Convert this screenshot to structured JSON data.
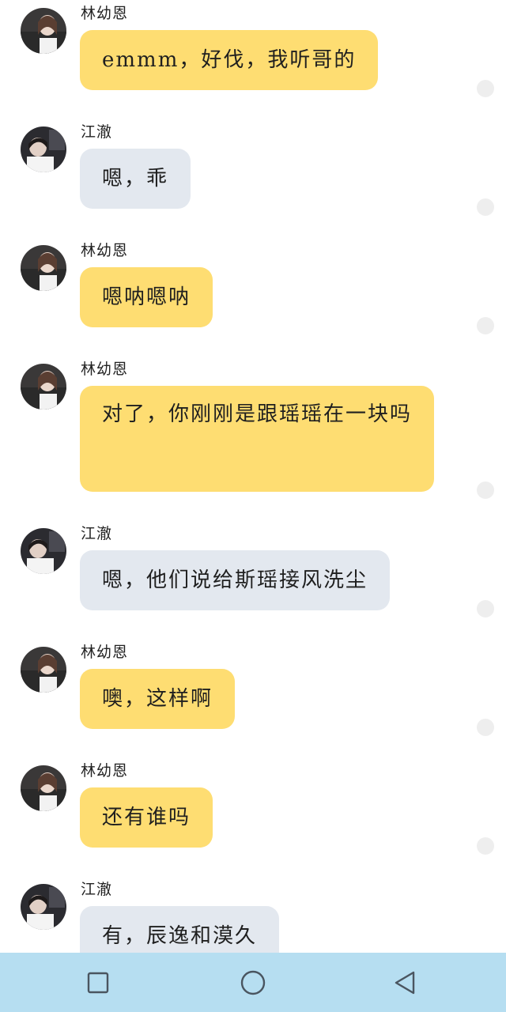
{
  "messages": [
    {
      "sender": "林幼恩",
      "text": "emmm，好伐，我听哥的",
      "side": "her"
    },
    {
      "sender": "江澈",
      "text": "嗯，乖",
      "side": "him"
    },
    {
      "sender": "林幼恩",
      "text": "嗯呐嗯呐",
      "side": "her"
    },
    {
      "sender": "林幼恩",
      "text": "对了，你刚刚是跟瑶瑶在一块吗",
      "side": "her"
    },
    {
      "sender": "江澈",
      "text": "嗯，他们说给斯瑶接风洗尘",
      "side": "him"
    },
    {
      "sender": "林幼恩",
      "text": "噢，这样啊",
      "side": "her"
    },
    {
      "sender": "林幼恩",
      "text": "还有谁吗",
      "side": "her"
    },
    {
      "sender": "江澈",
      "text": "有，辰逸和漠久",
      "side": "him"
    }
  ],
  "colors": {
    "her_bubble": "#fedd72",
    "him_bubble": "#e3e8ef",
    "navbar": "#b6def1"
  },
  "navbar": {
    "buttons": [
      "square-icon",
      "circle-icon",
      "triangle-back-icon"
    ]
  }
}
